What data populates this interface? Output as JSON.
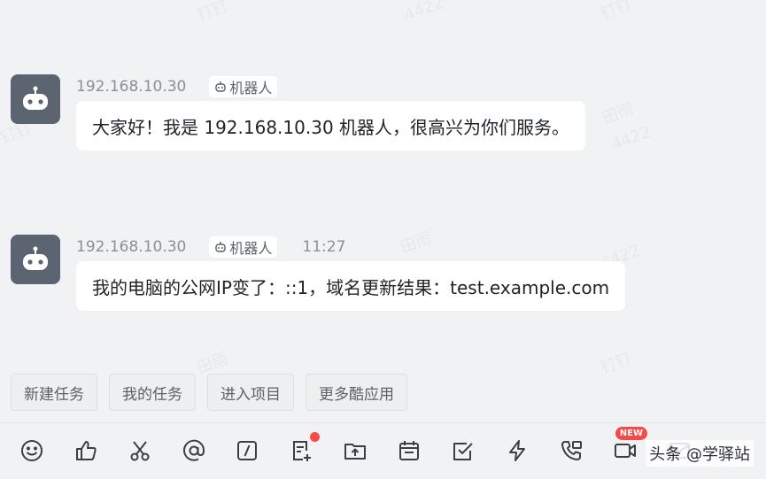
{
  "watermarks": [
    "4422",
    "钉钉",
    "田雨",
    "4422",
    "钉钉",
    "田雨",
    "4422",
    "钉钉"
  ],
  "messages": [
    {
      "sender": "192.168.10.30",
      "tag": "机器人",
      "time": "",
      "text": "大家好！我是 192.168.10.30 机器人，很高兴为你们服务。"
    },
    {
      "sender": "192.168.10.30",
      "tag": "机器人",
      "time": "11:27",
      "text": "我的电脑的公网IP变了：::1，域名更新结果：test.example.com"
    }
  ],
  "actions": [
    "新建任务",
    "我的任务",
    "进入项目",
    "更多酷应用"
  ],
  "toolbar": {
    "icons": [
      "emoji-icon",
      "thumbs-up-icon",
      "scissors-icon",
      "at-icon",
      "slash-icon",
      "note-icon",
      "upload-folder-icon",
      "calendar-icon",
      "check-icon",
      "lightning-icon",
      "phone-icon",
      "video-icon",
      "mail-icon"
    ],
    "new_badge": "NEW"
  },
  "corner_watermark": "头条 @学驿站",
  "colors": {
    "background": "#f1f2f4",
    "avatar": "#5b6470",
    "bubble": "#ffffff",
    "badge": "#f54a45"
  }
}
